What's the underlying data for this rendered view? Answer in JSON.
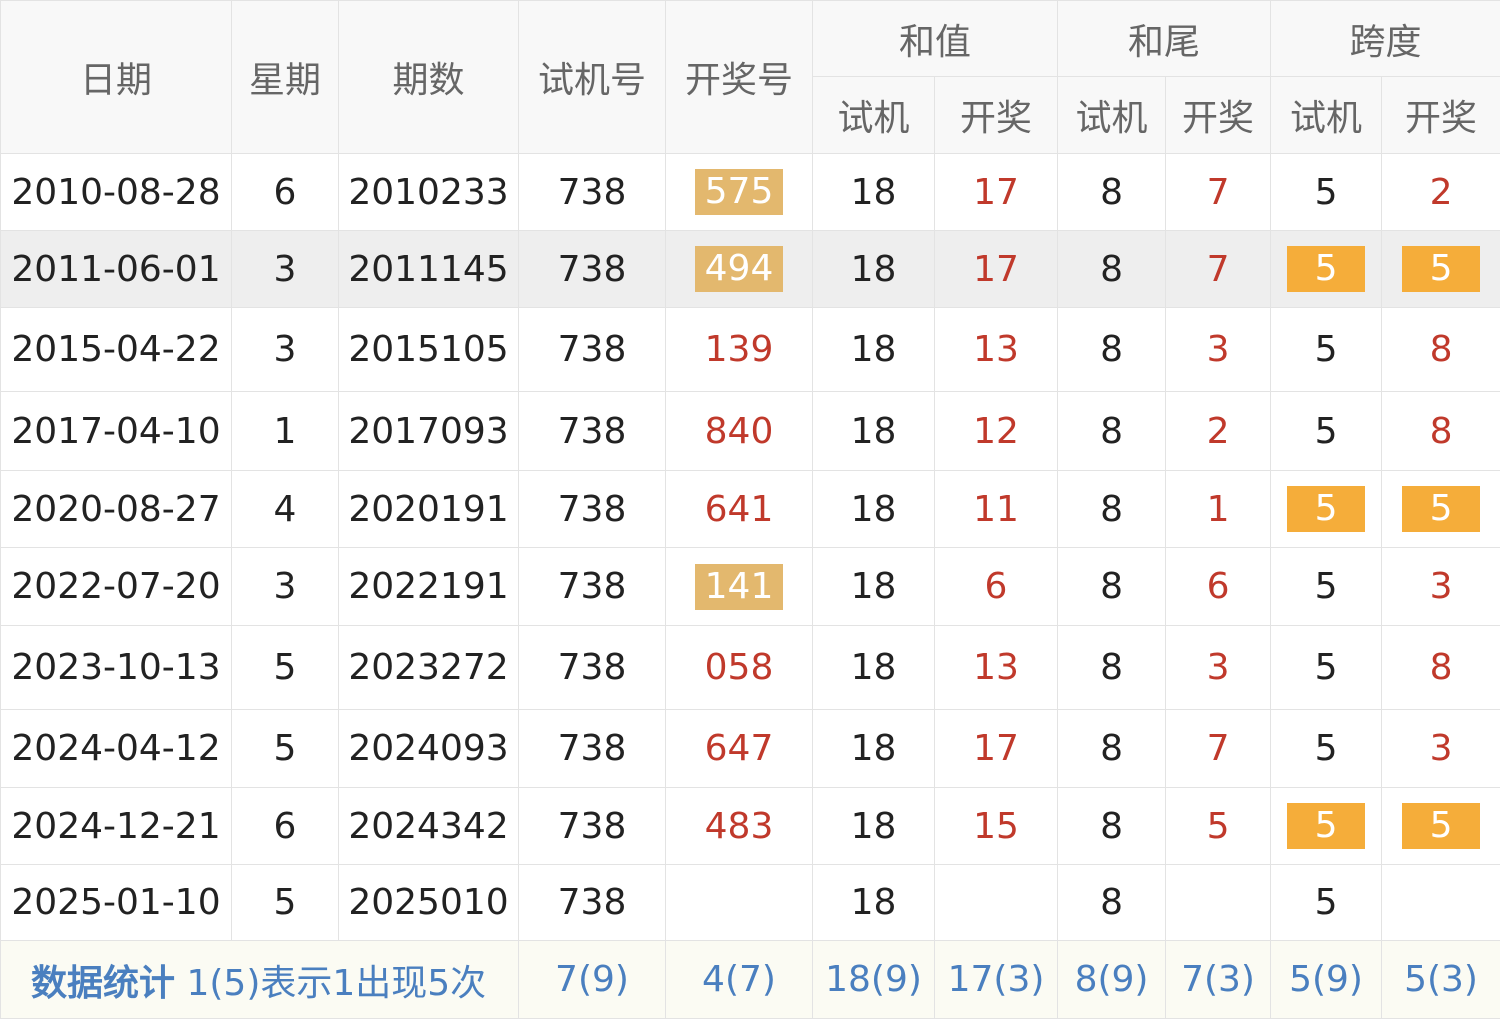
{
  "headers": {
    "date": "日期",
    "weekday": "星期",
    "issue": "期数",
    "trial": "试机号",
    "draw": "开奖号",
    "sum_group": "和值",
    "tail_group": "和尾",
    "span_group": "跨度",
    "sub_trial": "试机",
    "sub_draw": "开奖"
  },
  "rows": [
    {
      "date": "2010-08-28",
      "weekday": "6",
      "issue": "2010233",
      "trial": "738",
      "draw": "575",
      "draw_hl": "gold",
      "sum_trial": "18",
      "sum_draw": "17",
      "tail_trial": "8",
      "tail_draw": "7",
      "span_trial": "5",
      "span_draw": "2",
      "span_hl": ""
    },
    {
      "date": "2011-06-01",
      "weekday": "3",
      "issue": "2011145",
      "trial": "738",
      "draw": "494",
      "draw_hl": "gold",
      "sum_trial": "18",
      "sum_draw": "17",
      "tail_trial": "8",
      "tail_draw": "7",
      "span_trial": "5",
      "span_draw": "5",
      "span_hl": "orange"
    },
    {
      "date": "2015-04-22",
      "weekday": "3",
      "issue": "2015105",
      "trial": "738",
      "draw": "139",
      "draw_hl": "",
      "sum_trial": "18",
      "sum_draw": "13",
      "tail_trial": "8",
      "tail_draw": "3",
      "span_trial": "5",
      "span_draw": "8",
      "span_hl": ""
    },
    {
      "date": "2017-04-10",
      "weekday": "1",
      "issue": "2017093",
      "trial": "738",
      "draw": "840",
      "draw_hl": "",
      "sum_trial": "18",
      "sum_draw": "12",
      "tail_trial": "8",
      "tail_draw": "2",
      "span_trial": "5",
      "span_draw": "8",
      "span_hl": ""
    },
    {
      "date": "2020-08-27",
      "weekday": "4",
      "issue": "2020191",
      "trial": "738",
      "draw": "641",
      "draw_hl": "",
      "sum_trial": "18",
      "sum_draw": "11",
      "tail_trial": "8",
      "tail_draw": "1",
      "span_trial": "5",
      "span_draw": "5",
      "span_hl": "orange"
    },
    {
      "date": "2022-07-20",
      "weekday": "3",
      "issue": "2022191",
      "trial": "738",
      "draw": "141",
      "draw_hl": "gold",
      "sum_trial": "18",
      "sum_draw": "6",
      "tail_trial": "8",
      "tail_draw": "6",
      "span_trial": "5",
      "span_draw": "3",
      "span_hl": ""
    },
    {
      "date": "2023-10-13",
      "weekday": "5",
      "issue": "2023272",
      "trial": "738",
      "draw": "058",
      "draw_hl": "",
      "sum_trial": "18",
      "sum_draw": "13",
      "tail_trial": "8",
      "tail_draw": "3",
      "span_trial": "5",
      "span_draw": "8",
      "span_hl": ""
    },
    {
      "date": "2024-04-12",
      "weekday": "5",
      "issue": "2024093",
      "trial": "738",
      "draw": "647",
      "draw_hl": "",
      "sum_trial": "18",
      "sum_draw": "17",
      "tail_trial": "8",
      "tail_draw": "7",
      "span_trial": "5",
      "span_draw": "3",
      "span_hl": ""
    },
    {
      "date": "2024-12-21",
      "weekday": "6",
      "issue": "2024342",
      "trial": "738",
      "draw": "483",
      "draw_hl": "",
      "sum_trial": "18",
      "sum_draw": "15",
      "tail_trial": "8",
      "tail_draw": "5",
      "span_trial": "5",
      "span_draw": "5",
      "span_hl": "orange"
    },
    {
      "date": "2025-01-10",
      "weekday": "5",
      "issue": "2025010",
      "trial": "738",
      "draw": "",
      "draw_hl": "",
      "sum_trial": "18",
      "sum_draw": "",
      "tail_trial": "8",
      "tail_draw": "",
      "span_trial": "5",
      "span_draw": "",
      "span_hl": ""
    }
  ],
  "footer": {
    "title": "数据统计",
    "note": "1(5)表示1出现5次",
    "trial": "7(9)",
    "draw": "4(7)",
    "sum_trial": "18(9)",
    "sum_draw": "17(3)",
    "tail_trial": "8(9)",
    "tail_draw": "7(3)",
    "span_trial": "5(9)",
    "span_draw": "5(3)"
  },
  "colors": {
    "red_text": "#c0392b",
    "highlight_gold": "#e3b86e",
    "highlight_orange": "#f5ad3a",
    "stat_blue": "#4a7fbf",
    "alt_row": "#eeeeee"
  }
}
